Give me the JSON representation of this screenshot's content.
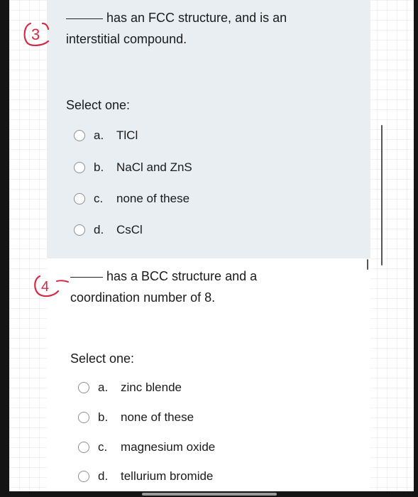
{
  "question3": {
    "annotation": "3",
    "text_line1": "has an FCC structure, and is an",
    "text_line2": "interstitial compound.",
    "select_label": "Select one:",
    "options": [
      {
        "letter": "a.",
        "text": "TlCl"
      },
      {
        "letter": "b.",
        "text": "NaCl and ZnS"
      },
      {
        "letter": "c.",
        "text": "none of these"
      },
      {
        "letter": "d.",
        "text": "CsCl"
      }
    ]
  },
  "question4": {
    "annotation": "4",
    "text_line1": "has a BCC structure and a",
    "text_line2": "coordination number of 8.",
    "select_label": "Select one:",
    "options": [
      {
        "letter": "a.",
        "text": "zinc blende"
      },
      {
        "letter": "b.",
        "text": "none of these"
      },
      {
        "letter": "c.",
        "text": "magnesium oxide"
      },
      {
        "letter": "d.",
        "text": "tellurium bromide"
      }
    ]
  },
  "colors": {
    "panel_background": "#e8eef2",
    "annotation_ink": "#d42a45",
    "radio_border": "#8a8f96"
  }
}
